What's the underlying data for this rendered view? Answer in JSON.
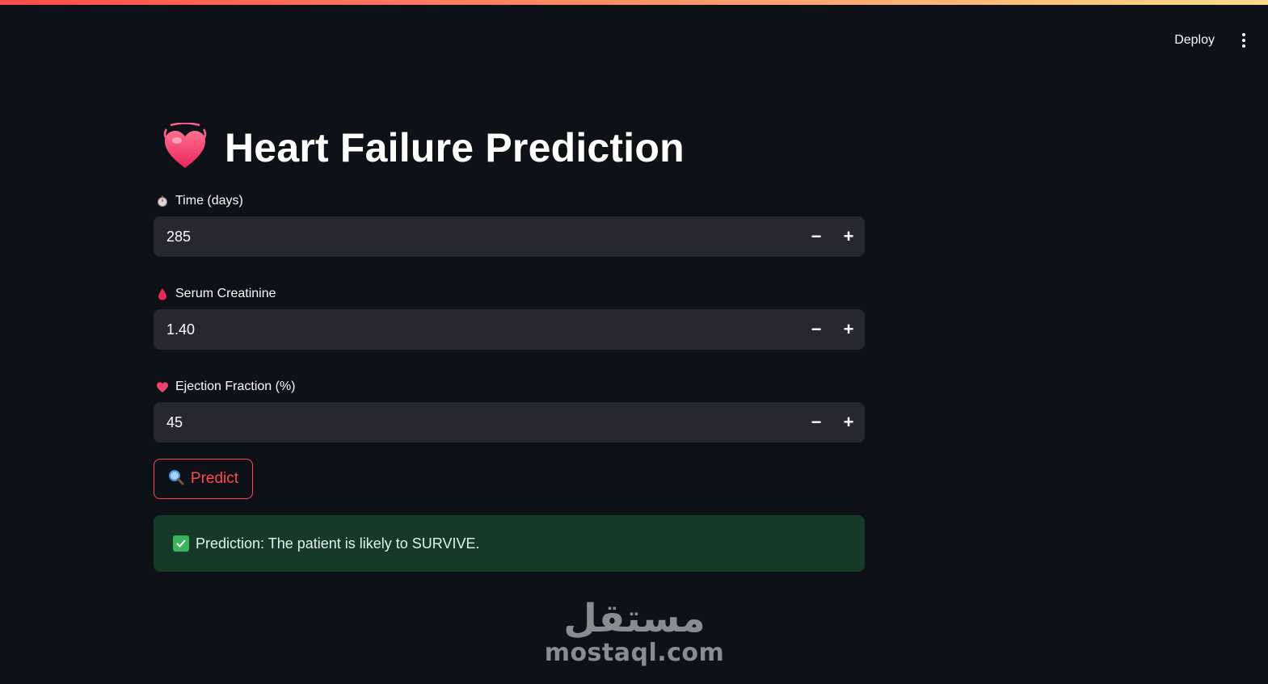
{
  "header": {
    "deploy_label": "Deploy",
    "menu_icon": "kebab-menu-icon"
  },
  "main": {
    "title": "Heart Failure Prediction",
    "title_icon": "beating-heart-icon",
    "fields": [
      {
        "label": "Time (days)",
        "icon": "stopwatch-icon",
        "value": "285"
      },
      {
        "label": "Serum Creatinine",
        "icon": "blood-drop-icon",
        "value": "1.40"
      },
      {
        "label": "Ejection Fraction (%)",
        "icon": "heart-icon",
        "value": "45"
      }
    ],
    "stepper": {
      "minus": "−",
      "plus": "+"
    },
    "predict_button": {
      "label": "Predict",
      "icon": "magnifier-icon"
    },
    "result": {
      "text": "Prediction: The patient is likely to SURVIVE.",
      "icon": "check-mark-icon"
    }
  },
  "watermark": {
    "arabic": "مستقل",
    "latin": "mostaql.com"
  },
  "colors": {
    "background": "#0e1117",
    "input_bg": "#262730",
    "accent": "#ff4b4b",
    "success_bg": "#173928",
    "success_check": "#3bb55b"
  }
}
